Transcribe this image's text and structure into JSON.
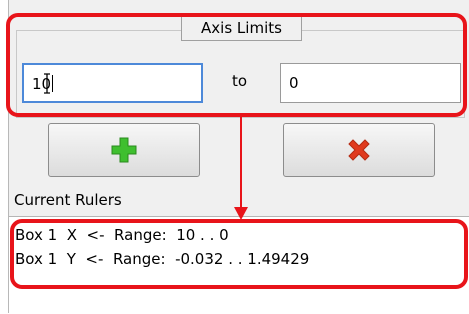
{
  "axis_limits": {
    "title": "Axis Limits",
    "from_value": "10",
    "to_label": "to",
    "to_value": "0"
  },
  "buttons": {
    "add_icon": "plus-icon",
    "cancel_icon": "x-icon"
  },
  "current_rulers": {
    "label": "Current Rulers",
    "items": [
      "Box 1  X  <-  Range:  10 . . 0",
      "Box 1  Y  <-  Range:  -0.032 . . 1.49429"
    ]
  },
  "colors": {
    "highlight": "#e8141a",
    "plus": "#3fbf2f",
    "cross": "#e03a1e",
    "focus_border": "#4d89d9"
  }
}
